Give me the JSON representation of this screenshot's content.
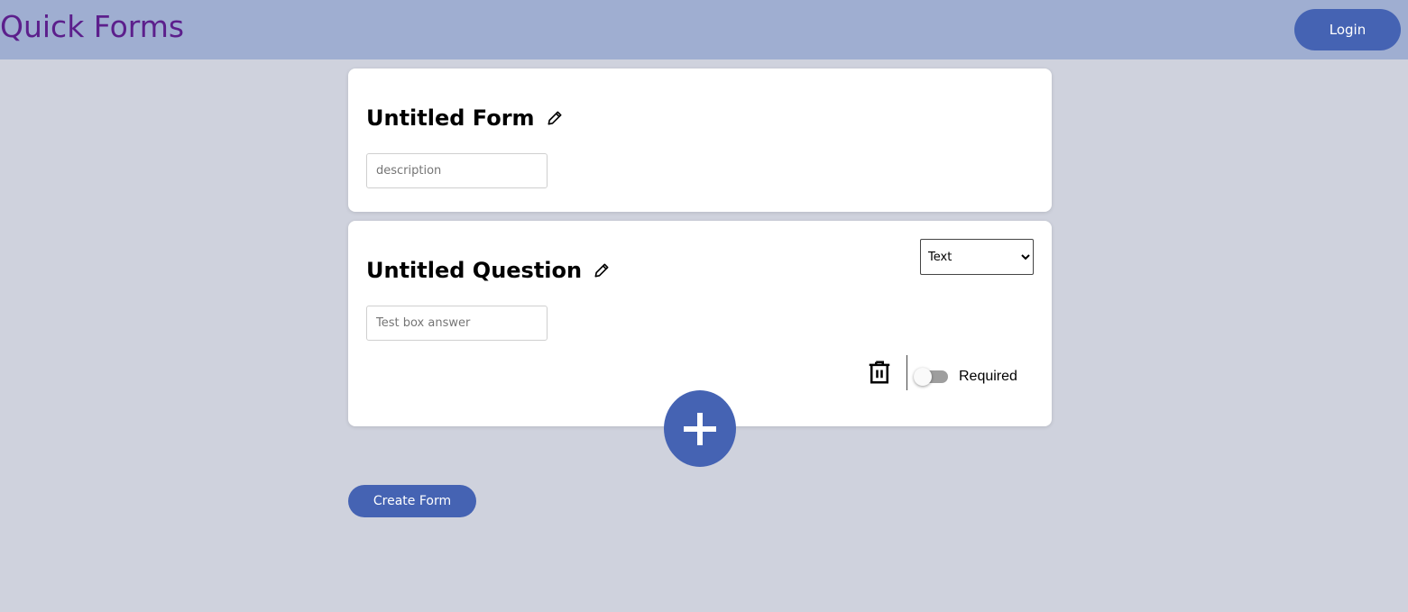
{
  "header": {
    "app_title": "Quick Forms",
    "login_label": "Login"
  },
  "form_card": {
    "title": "Untitled Form",
    "description_placeholder": "description",
    "description_value": ""
  },
  "question_card": {
    "title": "Untitled Question",
    "answer_placeholder": "Test box answer",
    "answer_value": "",
    "type_selected": "Text",
    "required_label": "Required",
    "required_on": false
  },
  "actions": {
    "create_form_label": "Create Form"
  },
  "icons": {
    "edit_title": "pencil-icon",
    "delete_question": "trash-icon",
    "add_question": "plus-icon"
  },
  "colors": {
    "header_bg": "#9faed1",
    "page_bg": "#cfd2dd",
    "accent": "#4563b3",
    "title_text": "#5c1f8c"
  }
}
